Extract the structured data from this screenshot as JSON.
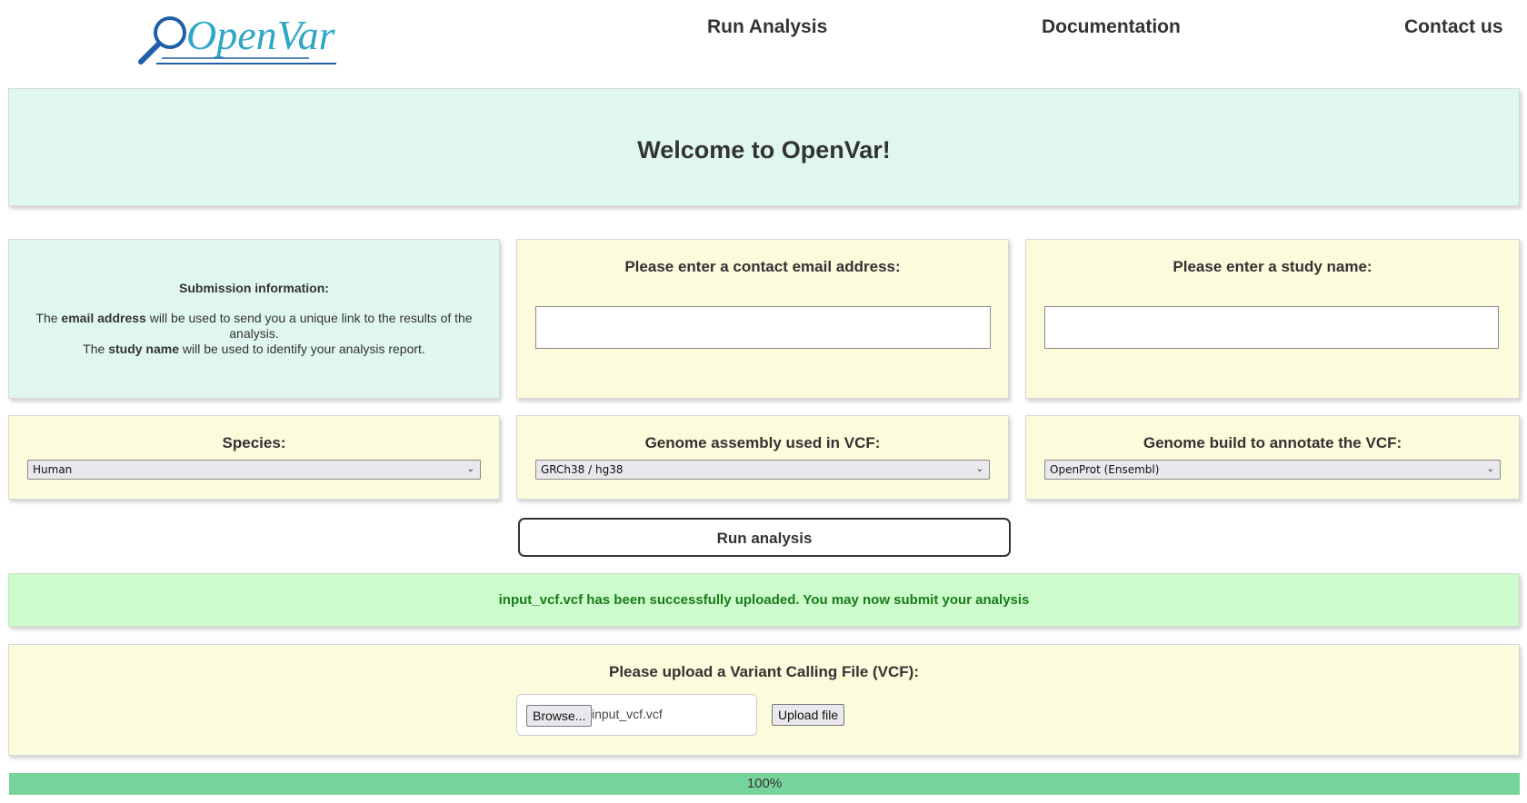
{
  "header": {
    "logo_text": "OpenVar",
    "nav": {
      "run_analysis": "Run Analysis",
      "documentation": "Documentation",
      "contact": "Contact us"
    }
  },
  "welcome": {
    "title": "Welcome to OpenVar!"
  },
  "submission_info": {
    "title": "Submission information:",
    "line1_prefix": "The ",
    "line1_bold": "email address",
    "line1_suffix": " will be used to send you a unique link to the results of the analysis.",
    "line2_prefix": "The ",
    "line2_bold": "study name",
    "line2_suffix": " will be used to identify your analysis report."
  },
  "email": {
    "label": "Please enter a contact email address:",
    "value": ""
  },
  "study": {
    "label": "Please enter a study name:",
    "value": ""
  },
  "species": {
    "label": "Species:",
    "selected": "Human"
  },
  "assembly": {
    "label": "Genome assembly used in VCF:",
    "selected": "GRCh38 / hg38"
  },
  "build": {
    "label": "Genome build to annotate the VCF:",
    "selected": "OpenProt (Ensembl)"
  },
  "run_button": {
    "label": "Run analysis"
  },
  "status": {
    "message": "input_vcf.vcf has been successfully uploaded. You may now submit your analysis"
  },
  "upload": {
    "label": "Please upload a Variant Calling File (VCF):",
    "browse_label": "Browse...",
    "file_name": "input_vcf.vcf",
    "upload_label": "Upload file"
  },
  "progress": {
    "value": 100,
    "label": "100%"
  },
  "colors": {
    "mint_panel": "#e0f7f0",
    "cream_panel": "#fcfbdc",
    "success_panel": "#ccfccc",
    "success_text": "#1a7a1a",
    "progress_fill": "#77d39c",
    "logo_blue": "#1f5fa8",
    "logo_cyan": "#2fa6c8"
  }
}
